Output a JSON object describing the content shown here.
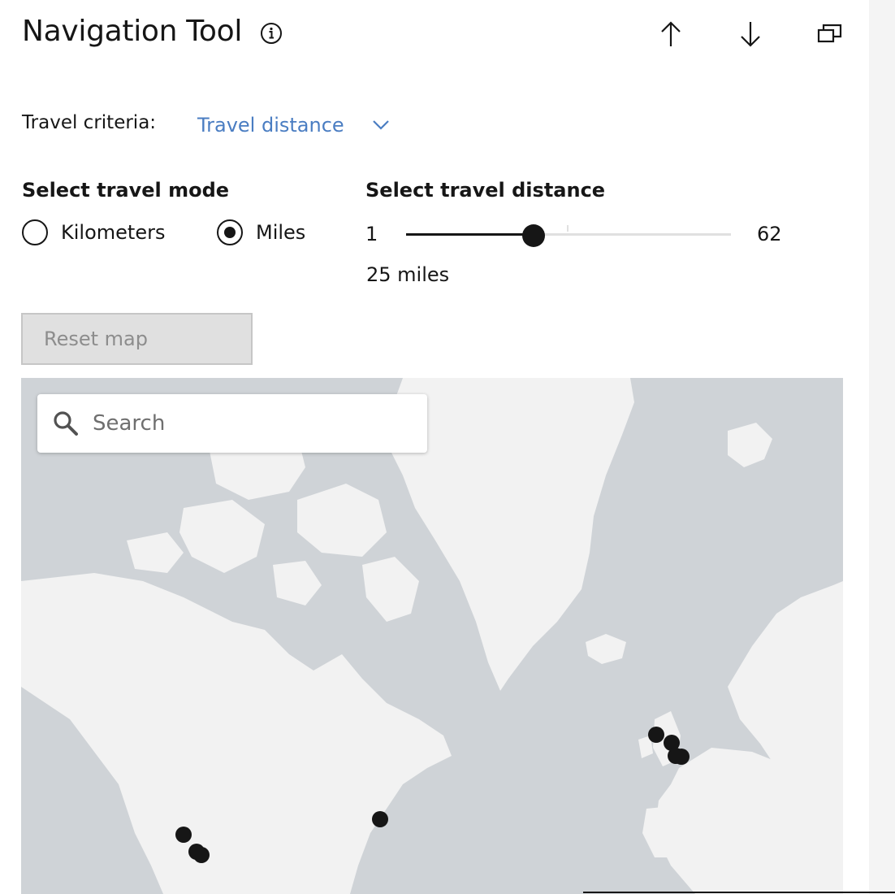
{
  "header": {
    "title": "Navigation Tool",
    "info_icon": "info-icon",
    "actions": [
      {
        "name": "move-up",
        "icon": "arrow-up-icon"
      },
      {
        "name": "move-down",
        "icon": "arrow-down-icon"
      },
      {
        "name": "popout",
        "icon": "popout-icon"
      }
    ]
  },
  "criteria": {
    "label": "Travel criteria:",
    "value": "Travel distance",
    "accent_color": "#4a7dc2"
  },
  "travel_mode": {
    "heading": "Select travel mode",
    "options": [
      {
        "label": "Kilometers",
        "selected": false
      },
      {
        "label": "Miles",
        "selected": true
      }
    ]
  },
  "travel_distance": {
    "heading": "Select travel distance",
    "min": "1",
    "max": "62",
    "value": 25,
    "value_text": "25 miles"
  },
  "reset_button": {
    "label": "Reset map",
    "disabled": true
  },
  "map": {
    "search_placeholder": "Search",
    "markers": [
      {
        "name": "marker-northern-england"
      },
      {
        "name": "marker-england-central"
      },
      {
        "name": "marker-london-west"
      },
      {
        "name": "marker-london-east"
      },
      {
        "name": "marker-new-york"
      },
      {
        "name": "marker-san-francisco"
      },
      {
        "name": "marker-san-jose"
      },
      {
        "name": "marker-santa-cruz"
      }
    ]
  }
}
